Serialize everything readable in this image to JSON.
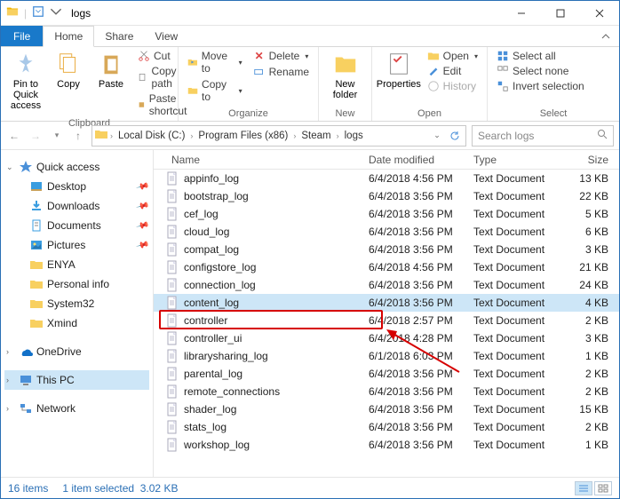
{
  "window": {
    "title": "logs"
  },
  "tabs": {
    "file": "File",
    "home": "Home",
    "share": "Share",
    "view": "View"
  },
  "ribbon": {
    "clipboard": {
      "name": "Clipboard",
      "pin": "Pin to Quick access",
      "copy": "Copy",
      "paste": "Paste",
      "cut": "Cut",
      "copypath": "Copy path",
      "pasteshort": "Paste shortcut"
    },
    "organize": {
      "name": "Organize",
      "moveto": "Move to",
      "copyto": "Copy to",
      "delete": "Delete",
      "rename": "Rename"
    },
    "new": {
      "name": "New",
      "newfolder": "New folder"
    },
    "open": {
      "name": "Open",
      "properties": "Properties",
      "open": "Open",
      "edit": "Edit",
      "history": "History"
    },
    "select": {
      "name": "Select",
      "all": "Select all",
      "none": "Select none",
      "invert": "Invert selection"
    }
  },
  "breadcrumbs": [
    "Local Disk (C:)",
    "Program Files (x86)",
    "Steam",
    "logs"
  ],
  "search_placeholder": "Search logs",
  "columns": {
    "name": "Name",
    "date": "Date modified",
    "type": "Type",
    "size": "Size"
  },
  "nav": {
    "quick": "Quick access",
    "items": [
      {
        "label": "Desktop",
        "pinned": true
      },
      {
        "label": "Downloads",
        "pinned": true
      },
      {
        "label": "Documents",
        "pinned": true
      },
      {
        "label": "Pictures",
        "pinned": true
      },
      {
        "label": "ENYA",
        "pinned": false
      },
      {
        "label": "Personal info",
        "pinned": false
      },
      {
        "label": "System32",
        "pinned": false
      },
      {
        "label": "Xmind",
        "pinned": false
      }
    ],
    "onedrive": "OneDrive",
    "thispc": "This PC",
    "network": "Network"
  },
  "files": [
    {
      "name": "appinfo_log",
      "date": "6/4/2018 4:56 PM",
      "type": "Text Document",
      "size": "13 KB"
    },
    {
      "name": "bootstrap_log",
      "date": "6/4/2018 3:56 PM",
      "type": "Text Document",
      "size": "22 KB"
    },
    {
      "name": "cef_log",
      "date": "6/4/2018 3:56 PM",
      "type": "Text Document",
      "size": "5 KB"
    },
    {
      "name": "cloud_log",
      "date": "6/4/2018 3:56 PM",
      "type": "Text Document",
      "size": "6 KB"
    },
    {
      "name": "compat_log",
      "date": "6/4/2018 3:56 PM",
      "type": "Text Document",
      "size": "3 KB"
    },
    {
      "name": "configstore_log",
      "date": "6/4/2018 4:56 PM",
      "type": "Text Document",
      "size": "21 KB"
    },
    {
      "name": "connection_log",
      "date": "6/4/2018 3:56 PM",
      "type": "Text Document",
      "size": "24 KB"
    },
    {
      "name": "content_log",
      "date": "6/4/2018 3:56 PM",
      "type": "Text Document",
      "size": "4 KB",
      "selected": true
    },
    {
      "name": "controller",
      "date": "6/4/2018 2:57 PM",
      "type": "Text Document",
      "size": "2 KB"
    },
    {
      "name": "controller_ui",
      "date": "6/4/2018 4:28 PM",
      "type": "Text Document",
      "size": "3 KB"
    },
    {
      "name": "librarysharing_log",
      "date": "6/1/2018 6:03 PM",
      "type": "Text Document",
      "size": "1 KB"
    },
    {
      "name": "parental_log",
      "date": "6/4/2018 3:56 PM",
      "type": "Text Document",
      "size": "2 KB"
    },
    {
      "name": "remote_connections",
      "date": "6/4/2018 3:56 PM",
      "type": "Text Document",
      "size": "2 KB"
    },
    {
      "name": "shader_log",
      "date": "6/4/2018 3:56 PM",
      "type": "Text Document",
      "size": "15 KB"
    },
    {
      "name": "stats_log",
      "date": "6/4/2018 3:56 PM",
      "type": "Text Document",
      "size": "2 KB"
    },
    {
      "name": "workshop_log",
      "date": "6/4/2018 3:56 PM",
      "type": "Text Document",
      "size": "1 KB"
    }
  ],
  "status": {
    "count": "16 items",
    "selected": "1 item selected",
    "size": "3.02 KB"
  }
}
